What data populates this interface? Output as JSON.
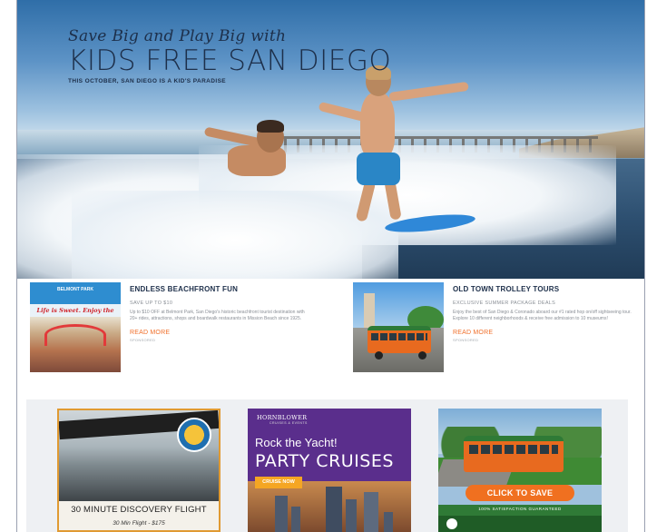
{
  "hero": {
    "script_text": "Save Big and Play Big with",
    "title": "KIDS FREE SAN DIEGO",
    "subtitle": "THIS OCTOBER, SAN DIEGO IS A KID'S PARADISE"
  },
  "features": [
    {
      "title": "ENDLESS BEACHFRONT FUN",
      "subtitle": "SAVE UP TO $10",
      "body": "Up to $10 OFF at Belmont Park, San Diego's historic beachfront tourist destination with 20+ rides, attractions, shops and boardwalk restaurants in Mission Beach since 1925.",
      "link": "READ MORE",
      "tag": "SPONSORED",
      "image": {
        "logo_text": "BELMONT PARK",
        "tagline": "Life is Sweet. Enjoy the Ride."
      }
    },
    {
      "title": "OLD TOWN TROLLEY TOURS",
      "subtitle": "EXCLUSIVE SUMMER PACKAGE DEALS",
      "body": "Enjoy the best of San Diego & Coronado aboard our #1 rated hop on/off sightseeing tour. Explore 10 different neighborhoods & receive free admission to 10 museums!",
      "link": "READ MORE",
      "tag": "SPONSORED"
    }
  ],
  "ads": [
    {
      "label": "30 MINUTE DISCOVERY FLIGHT",
      "sublabel": "30 Min Flight - $175"
    },
    {
      "brand": "HORNBLOWER",
      "brand_sub": "CRUISES & EVENTS",
      "headline": "Rock the Yacht!",
      "title": "PARTY CRUISES",
      "cta": "CRUISE NOW"
    },
    {
      "cta": "CLICK TO SAVE",
      "guarantee": "100% SATISFACTION GUARANTEED"
    }
  ]
}
